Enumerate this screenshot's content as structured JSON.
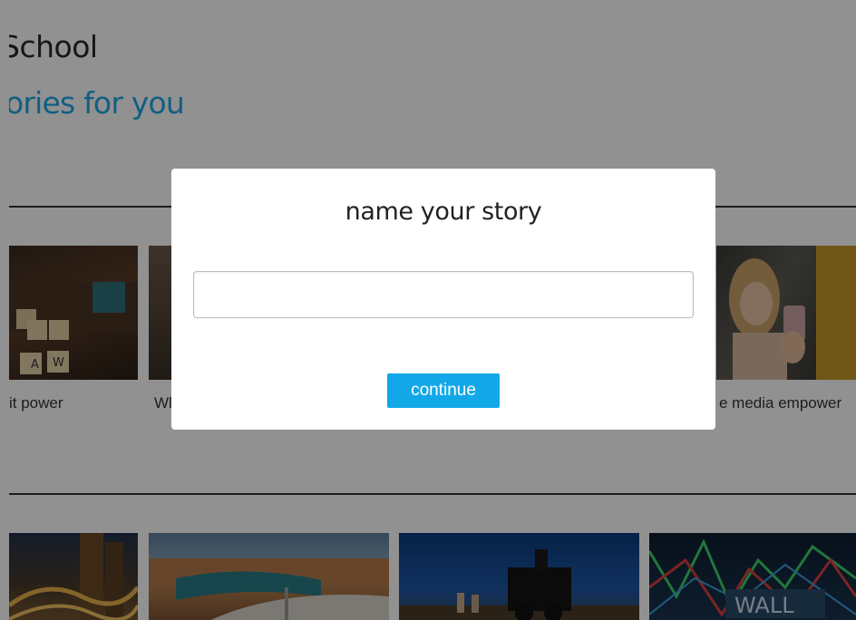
{
  "background_page": {
    "site_title": "School",
    "section_title": "ories for you",
    "row1": [
      {
        "caption": "it power"
      },
      {
        "caption": "Wl"
      },
      {
        "caption": "e media empower"
      }
    ]
  },
  "modal": {
    "title": "name your story",
    "input_value": "",
    "continue_label": "continue"
  },
  "colors": {
    "accent": "#12a8e8",
    "section_title": "#1ea7e6",
    "overlay": "rgba(0,0,0,0.43)"
  }
}
